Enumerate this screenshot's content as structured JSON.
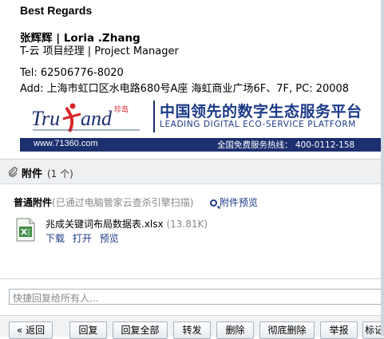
{
  "signature": {
    "closing": "Best Regards",
    "name": "张辉辉 | Loria .Zhang",
    "title": "T-云 项目经理 | Project Manager",
    "tel": "Tel: 62506776-8020",
    "address": "Add: 上海市虹口区水电路680号A座 海虹商业广场6F、7F, PC: 20008"
  },
  "banner": {
    "logo_text": "TruLand",
    "logo_cn": "珍岛",
    "slogan_cn": "中国领先的数字生态服务平台",
    "slogan_en": "LEADING DIGITAL ECO-SERVICE PLATFORM",
    "url": "www.71360.com",
    "hotline": "全国免费服务热线： 400-0112-158"
  },
  "attachments": {
    "header_label": "附件",
    "count": "(1 个)",
    "group_title": "普通附件",
    "scan_note": "(已通过电脑管家云查杀引擎扫描)",
    "preview_link": "附件预览",
    "file": {
      "name": "兆成关键词布局数据表.xlsx",
      "size": "(13.81K)",
      "actions": [
        "下载",
        "打开",
        "预览"
      ]
    }
  },
  "reply": {
    "placeholder": "快捷回复给所有人..."
  },
  "toolbar": {
    "buttons": [
      "« 返回",
      "回复",
      "回复全部",
      "转发",
      "删除",
      "彻底删除",
      "举报",
      "标记"
    ]
  },
  "colors": {
    "brand_blue": "#1c2f6e",
    "link_blue": "#1c3a87",
    "logo_red": "#d6262b"
  }
}
